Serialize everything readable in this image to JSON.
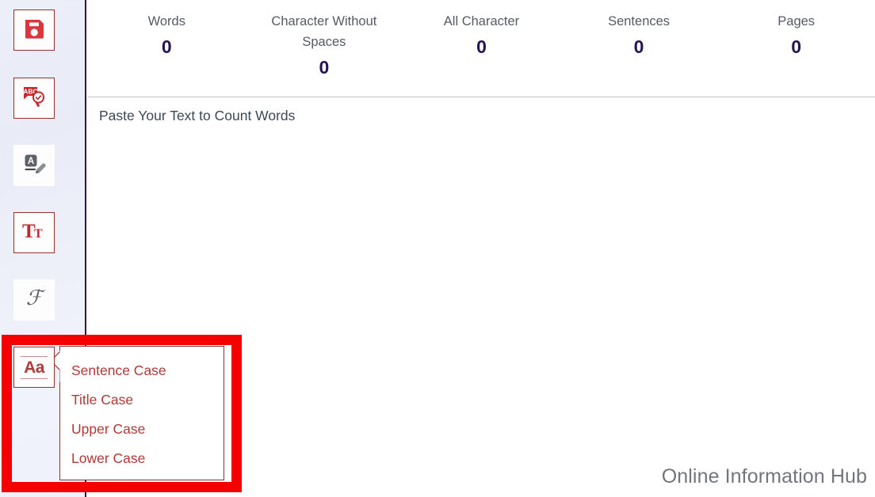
{
  "sidebar": {
    "buttons": [
      {
        "name": "save-icon",
        "label": "Save",
        "style": "bordered"
      },
      {
        "name": "spell-check-icon",
        "label": "Spell Check",
        "style": "bordered"
      },
      {
        "name": "edit-text-icon",
        "label": "Edit Text",
        "style": "plain"
      },
      {
        "name": "font-size-icon",
        "label": "Font Size",
        "style": "bordered"
      },
      {
        "name": "font-style-icon",
        "label": "Font Style",
        "style": "plain"
      },
      {
        "name": "change-case-icon",
        "label": "Change Case",
        "style": "bordered",
        "glyph": "Aa"
      }
    ]
  },
  "stats": [
    {
      "label": "Words",
      "value": "0"
    },
    {
      "label": "Character Without Spaces",
      "value": "0"
    },
    {
      "label": "All Character",
      "value": "0"
    },
    {
      "label": "Sentences",
      "value": "0"
    },
    {
      "label": "Pages",
      "value": "0"
    }
  ],
  "editor": {
    "placeholder": "Paste Your Text to Count Words",
    "value": ""
  },
  "brand": {
    "text": "Online Information Hub"
  },
  "case_menu": {
    "items": [
      {
        "label": "Sentence Case"
      },
      {
        "label": "Title Case"
      },
      {
        "label": "Upper Case"
      },
      {
        "label": "Lower Case"
      }
    ]
  },
  "colors": {
    "accent_red": "#b33838",
    "highlight_red": "#f50000",
    "stat_value": "#241452",
    "sidebar_divider": "#2b1a4a",
    "muted_text": "#555b63"
  }
}
